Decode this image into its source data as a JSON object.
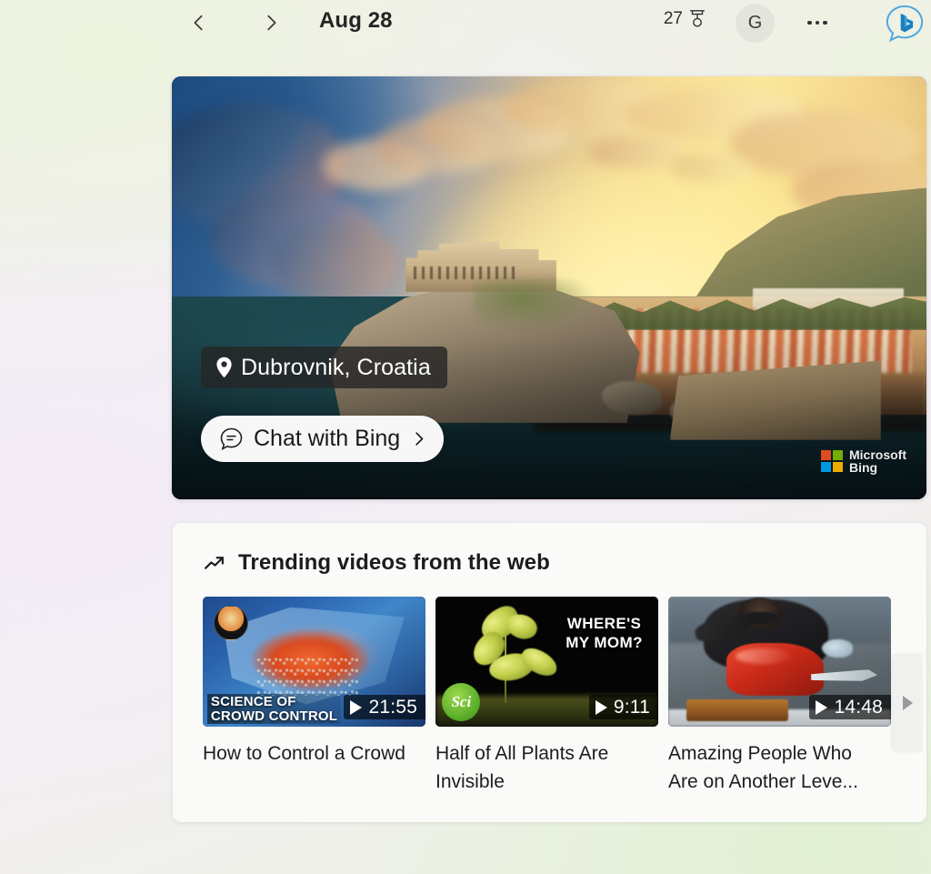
{
  "header": {
    "prev_icon": "chevron-left-icon",
    "next_icon": "chevron-right-icon",
    "date": "Aug 28",
    "rewards_count": "27",
    "rewards_icon": "rewards-medal-icon",
    "avatar_initial": "G",
    "more_icon": "ellipsis-icon",
    "bing_chat_icon": "bing-chat-bubble-icon"
  },
  "hero": {
    "location": "Dubrovnik, Croatia",
    "location_icon": "map-pin-icon",
    "chat_button_label": "Chat with Bing",
    "chat_button_icon": "chat-bubble-icon",
    "chat_button_chevron": "chevron-right-icon",
    "watermark_line1": "Microsoft",
    "watermark_line2": "Bing",
    "watermark_icon": "microsoft-logo-icon",
    "ms_colors": {
      "red": "#f25022",
      "green": "#7fba00",
      "blue": "#00a4ef",
      "yellow": "#ffb900"
    }
  },
  "trending": {
    "title": "Trending videos from the web",
    "icon": "trending-up-arrow-icon",
    "scroll_next_icon": "scroll-right-arrow-icon",
    "videos": [
      {
        "title": "How to Control a Crowd",
        "duration": "21:55",
        "thumb_caption_line1": "SCIENCE OF",
        "thumb_caption_line2": "CROWD CONTROL",
        "play_icon": "play-icon"
      },
      {
        "title": "Half of All Plants Are Invisible",
        "duration": "9:11",
        "thumb_caption_line1": "WHERE'S",
        "thumb_caption_line2": "MY MOM?",
        "channel_logo_text": "Sci",
        "play_icon": "play-icon"
      },
      {
        "title": "Amazing People Who Are on Another Leve...",
        "duration": "14:48",
        "play_icon": "play-icon"
      }
    ]
  }
}
